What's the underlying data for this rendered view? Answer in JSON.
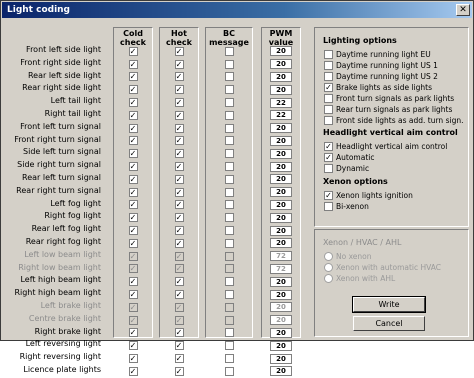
{
  "window": {
    "title": "Light coding",
    "close_glyph": "✕"
  },
  "columns": {
    "cold": "Cold\ncheck",
    "hot": "Hot\ncheck",
    "bc": "BC\nmessage",
    "pwm": "PWM\nvalue"
  },
  "rows": [
    {
      "label": "Front left side light",
      "cold": true,
      "hot": true,
      "bc": false,
      "pwm": "20",
      "disabled": false
    },
    {
      "label": "Front right side light",
      "cold": true,
      "hot": true,
      "bc": false,
      "pwm": "20",
      "disabled": false
    },
    {
      "label": "Rear left side light",
      "cold": true,
      "hot": true,
      "bc": false,
      "pwm": "20",
      "disabled": false
    },
    {
      "label": "Rear right side light",
      "cold": true,
      "hot": true,
      "bc": false,
      "pwm": "20",
      "disabled": false
    },
    {
      "label": "Left tail light",
      "cold": true,
      "hot": true,
      "bc": false,
      "pwm": "22",
      "disabled": false
    },
    {
      "label": "Right tail light",
      "cold": true,
      "hot": true,
      "bc": false,
      "pwm": "22",
      "disabled": false
    },
    {
      "label": "Front left turn signal",
      "cold": true,
      "hot": true,
      "bc": false,
      "pwm": "20",
      "disabled": false
    },
    {
      "label": "Front right turn signal",
      "cold": true,
      "hot": true,
      "bc": false,
      "pwm": "20",
      "disabled": false
    },
    {
      "label": "Side left turn signal",
      "cold": true,
      "hot": true,
      "bc": false,
      "pwm": "20",
      "disabled": false
    },
    {
      "label": "Side right turn signal",
      "cold": true,
      "hot": true,
      "bc": false,
      "pwm": "20",
      "disabled": false
    },
    {
      "label": "Rear left turn signal",
      "cold": true,
      "hot": true,
      "bc": false,
      "pwm": "20",
      "disabled": false
    },
    {
      "label": "Rear right turn signal",
      "cold": true,
      "hot": true,
      "bc": false,
      "pwm": "20",
      "disabled": false
    },
    {
      "label": "Left fog light",
      "cold": true,
      "hot": true,
      "bc": false,
      "pwm": "20",
      "disabled": false
    },
    {
      "label": "Right fog light",
      "cold": true,
      "hot": true,
      "bc": false,
      "pwm": "20",
      "disabled": false
    },
    {
      "label": "Rear left fog light",
      "cold": true,
      "hot": true,
      "bc": false,
      "pwm": "20",
      "disabled": false
    },
    {
      "label": "Rear right fog light",
      "cold": true,
      "hot": true,
      "bc": false,
      "pwm": "20",
      "disabled": false
    },
    {
      "label": "Left low beam light",
      "cold": true,
      "hot": true,
      "bc": false,
      "pwm": "72",
      "disabled": true
    },
    {
      "label": "Right low beam light",
      "cold": true,
      "hot": true,
      "bc": false,
      "pwm": "72",
      "disabled": true
    },
    {
      "label": "Left high beam light",
      "cold": true,
      "hot": true,
      "bc": false,
      "pwm": "20",
      "disabled": false
    },
    {
      "label": "Right high beam light",
      "cold": true,
      "hot": true,
      "bc": false,
      "pwm": "20",
      "disabled": false
    },
    {
      "label": "Left brake light",
      "cold": true,
      "hot": true,
      "bc": false,
      "pwm": "20",
      "disabled": true
    },
    {
      "label": "Centre brake light",
      "cold": true,
      "hot": true,
      "bc": false,
      "pwm": "20",
      "disabled": true
    },
    {
      "label": "Right brake light",
      "cold": true,
      "hot": true,
      "bc": false,
      "pwm": "20",
      "disabled": false
    },
    {
      "label": "Left reversing light",
      "cold": true,
      "hot": true,
      "bc": false,
      "pwm": "20",
      "disabled": false
    },
    {
      "label": "Right reversing light",
      "cold": true,
      "hot": true,
      "bc": false,
      "pwm": "20",
      "disabled": false
    },
    {
      "label": "Licence plate lights",
      "cold": true,
      "hot": true,
      "bc": false,
      "pwm": "20",
      "disabled": false
    }
  ],
  "lighting_options": {
    "title": "Lighting options",
    "items": [
      {
        "label": "Daytime running light EU",
        "checked": false
      },
      {
        "label": "Daytime running light US 1",
        "checked": false
      },
      {
        "label": "Daytime running light US 2",
        "checked": false
      },
      {
        "label": "Brake lights as side lights",
        "checked": true
      },
      {
        "label": "Front turn signals as park lights",
        "checked": false
      },
      {
        "label": "Rear turn signals as park lights",
        "checked": false
      },
      {
        "label": "Front side lights as add. turn sign.",
        "checked": false
      }
    ]
  },
  "headlight": {
    "title": "Headlight vertical aim control",
    "items": [
      {
        "label": "Headlight vertical aim control",
        "checked": true
      },
      {
        "label": "Automatic",
        "checked": true
      },
      {
        "label": "Dynamic",
        "checked": false
      }
    ]
  },
  "xenon": {
    "title": "Xenon options",
    "items": [
      {
        "label": "Xenon lights ignition",
        "checked": true
      },
      {
        "label": "Bi-xenon",
        "checked": false
      }
    ]
  },
  "hvac": {
    "title": "Xenon / HVAC / AHL",
    "items": [
      {
        "label": "No xenon"
      },
      {
        "label": "Xenon with automatic HVAC"
      },
      {
        "label": "Xenon with AHL"
      }
    ]
  },
  "buttons": {
    "write": "Write",
    "cancel": "Cancel"
  }
}
